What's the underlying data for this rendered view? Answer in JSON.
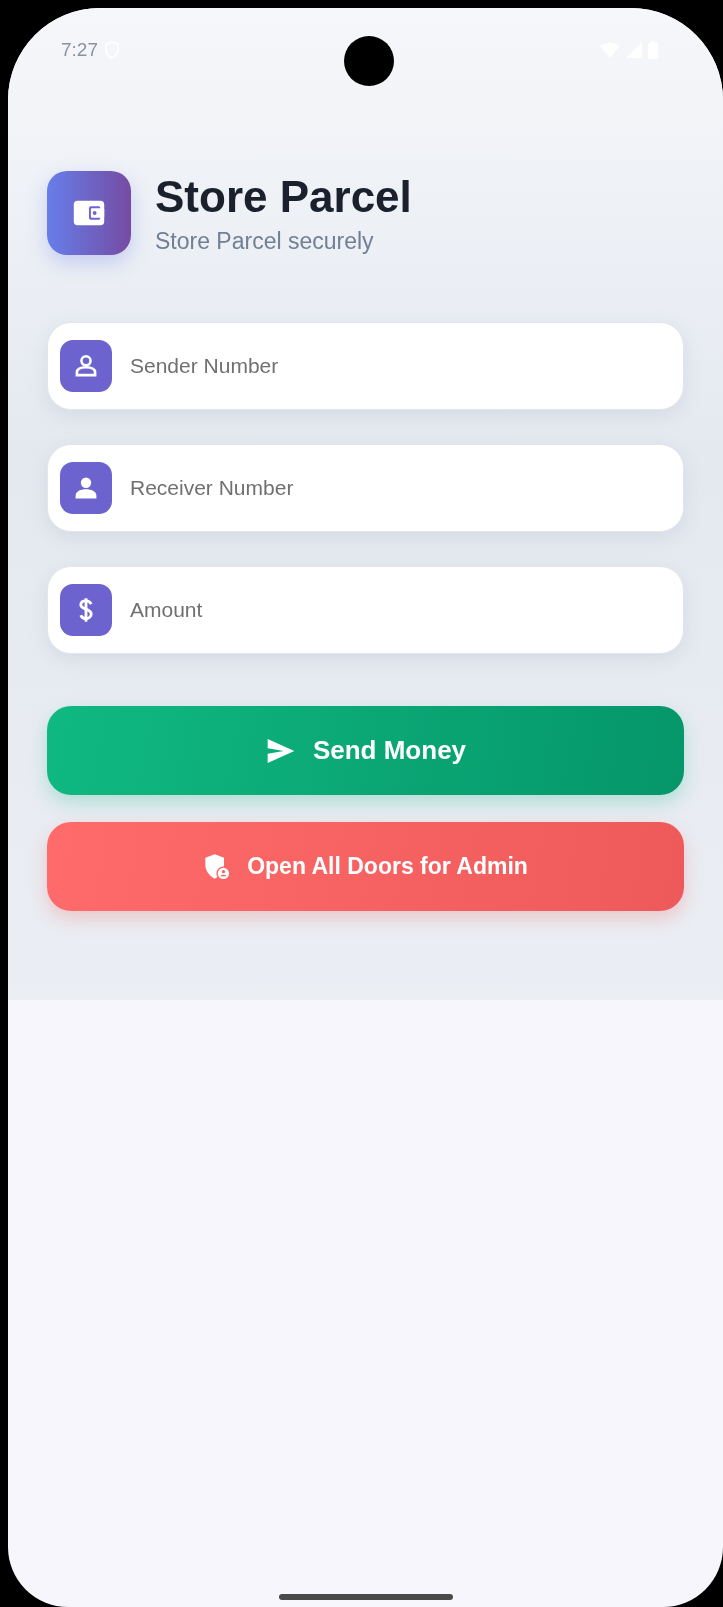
{
  "status_bar": {
    "time": "7:27"
  },
  "header": {
    "title": "Store Parcel",
    "subtitle": "Store Parcel securely"
  },
  "fields": [
    {
      "kind": "person-outline",
      "placeholder": "Sender Number"
    },
    {
      "kind": "person",
      "placeholder": "Receiver Number"
    },
    {
      "kind": "dollar",
      "placeholder": "Amount"
    }
  ],
  "buttons": [
    {
      "kind": "send",
      "label": "Send Money"
    },
    {
      "kind": "admin",
      "label": "Open All Doors for Admin"
    }
  ]
}
